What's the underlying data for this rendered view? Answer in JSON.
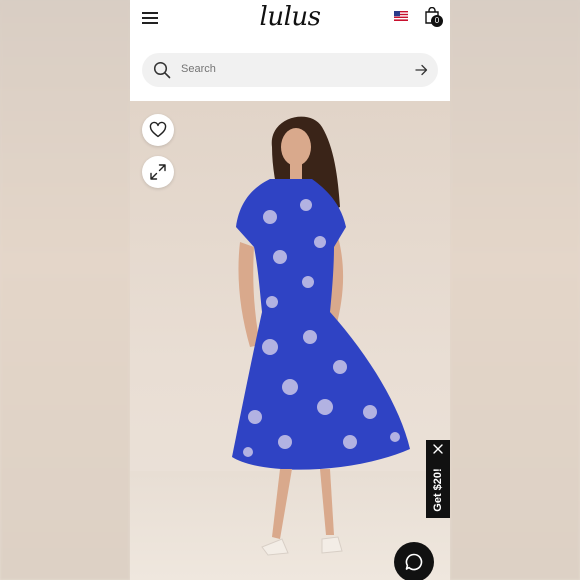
{
  "header": {
    "logo": "lulus",
    "cart_count": "0",
    "icons": {
      "menu": "hamburger-icon",
      "region": "us-flag-icon",
      "cart": "shopping-bag-icon"
    }
  },
  "search": {
    "placeholder": "Search",
    "icons": {
      "search": "search-icon",
      "submit": "arrow-right-icon"
    }
  },
  "product_image": {
    "icons": {
      "wishlist": "heart-icon",
      "zoom": "expand-icon"
    },
    "colors": {
      "dress": "#2f43c4",
      "print": "#c9c6e8"
    }
  },
  "promo": {
    "label": "Get $20!",
    "icons": {
      "close": "close-icon"
    }
  },
  "chat": {
    "icon": "chat-icon"
  },
  "colors": {
    "header_bg": "#ffffff",
    "search_bg": "#f1f1f1",
    "accent_dark": "#111111"
  }
}
